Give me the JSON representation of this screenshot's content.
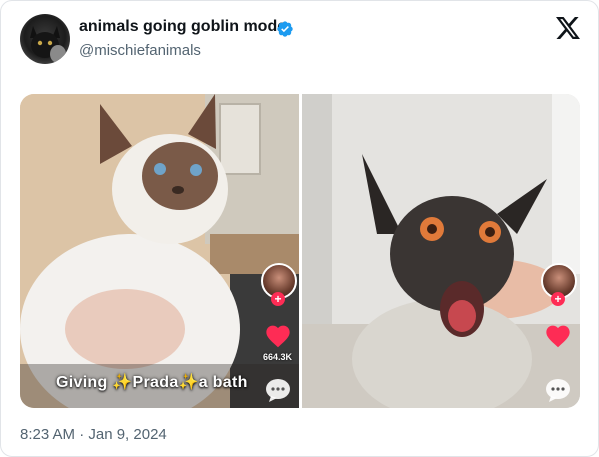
{
  "author": {
    "display_name": "animals going goblin mode",
    "handle": "@mischiefanimals",
    "verified": true,
    "avatar_icon": "black-cat-avatar"
  },
  "brand_icon": "x-logo-icon",
  "media": {
    "left_video": {
      "caption": "Giving ✨Prada✨a bath",
      "like_count": "664.3K"
    },
    "right_video": {}
  },
  "timestamp": "8:23 AM · Jan 9, 2024",
  "colors": {
    "verified_blue": "#1d9bf0",
    "tiktok_red": "#fe2c55",
    "muted_text": "#536471",
    "primary_text": "#0f1419"
  }
}
